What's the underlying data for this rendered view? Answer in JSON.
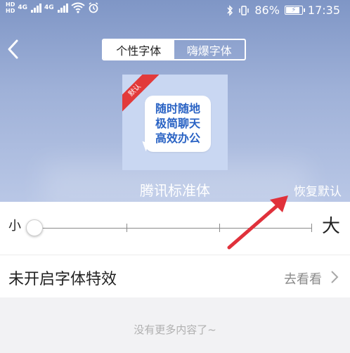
{
  "status_bar": {
    "left_top": "HD",
    "left_bottom": "HD",
    "signal1": "4G",
    "signal2": "4G",
    "battery_text": "86%",
    "time": "17:35",
    "icons": [
      "bluetooth-icon",
      "vibrate-icon",
      "wifi-icon",
      "alarm-icon",
      "battery-icon"
    ]
  },
  "header": {
    "tabs": [
      {
        "label": "个性字体",
        "active": true
      },
      {
        "label": "嗨爆字体",
        "active": false
      }
    ]
  },
  "preview": {
    "ribbon": "默认",
    "lines": [
      "随时随地",
      "极简聊天",
      "高效办公"
    ],
    "font_name": "腾讯标准体",
    "restore_label": "恢复默认"
  },
  "slider": {
    "small_label": "小",
    "large_label": "大",
    "value_fraction": 0,
    "steps": 5
  },
  "effect_row": {
    "label": "未开启字体特效",
    "action": "去看看"
  },
  "footer": {
    "empty_text": "没有更多内容了~"
  },
  "colors": {
    "header_bg": "#9fb1d8",
    "ribbon": "#e23a3a",
    "preview_text": "#2a63c4",
    "arrow": "#e0313b"
  }
}
